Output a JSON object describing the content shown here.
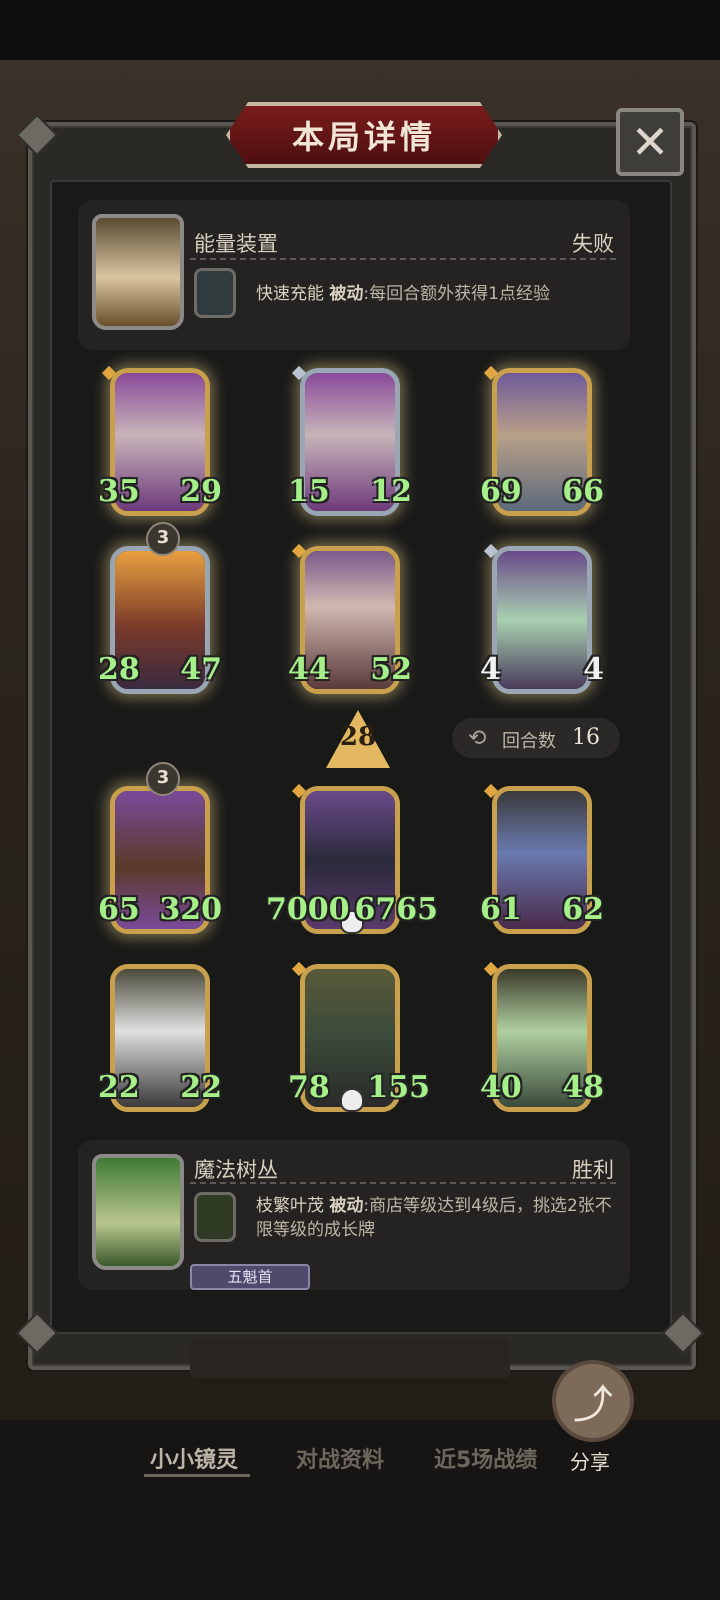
{
  "header": {
    "title": "本局详情",
    "close_icon": "close-icon"
  },
  "top_player": {
    "name": "能量装置",
    "result": "失败",
    "skill": {
      "name": "快速充能",
      "tag": "被动",
      "desc": ":每回合额外获得1点经验"
    }
  },
  "top_units": [
    {
      "atk": "35",
      "hp": "29",
      "frame": "gold"
    },
    {
      "atk": "15",
      "hp": "12",
      "frame": "silver"
    },
    {
      "atk": "69",
      "hp": "66",
      "frame": "gold"
    },
    {
      "atk": "28",
      "hp": "47",
      "frame": "silver",
      "tier": "3"
    },
    {
      "atk": "44",
      "hp": "52",
      "frame": "gold"
    },
    {
      "atk": "4",
      "hp": "4",
      "frame": "silver"
    }
  ],
  "middle": {
    "level": "28",
    "rounds_label": "回合数",
    "rounds_value": "16"
  },
  "bottom_units": [
    {
      "atk": "65",
      "hp": "320",
      "frame": "gold",
      "tier": "3"
    },
    {
      "atk": "7000",
      "hp": "6765",
      "frame": "gold"
    },
    {
      "atk": "61",
      "hp": "62",
      "frame": "gold"
    },
    {
      "atk": "22",
      "hp": "22",
      "frame": "gold"
    },
    {
      "atk": "78",
      "hp": "155",
      "frame": "gold"
    },
    {
      "atk": "40",
      "hp": "48",
      "frame": "gold"
    }
  ],
  "bottom_player": {
    "name": "魔法树丛",
    "result": "胜利",
    "badge": "五魁首",
    "skill": {
      "name": "枝繁叶茂",
      "tag": "被动",
      "desc": ":商店等级达到4级后，挑选2张不限等级的成长牌"
    }
  },
  "nav": {
    "tab1": "小小镜灵",
    "tab2": "对战资料",
    "tab3": "近5场战绩"
  },
  "share": {
    "label": "分享"
  },
  "colors": {
    "accent_red": "#7a1c1c",
    "stat_green": "#a6f08a",
    "gold_frame": "#c9a14e"
  }
}
